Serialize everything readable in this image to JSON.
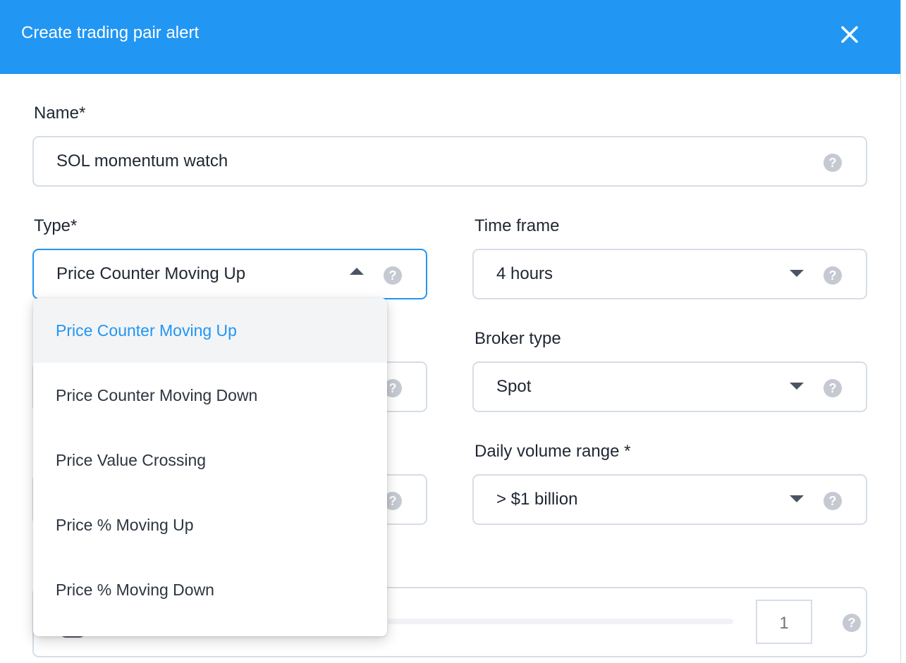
{
  "dialog": {
    "title": "Create trading pair alert",
    "close_icon": "close-icon",
    "accent_color": "#2196f3"
  },
  "form": {
    "name": {
      "label": "Name*",
      "value": "SOL momentum watch"
    },
    "type": {
      "label": "Type*",
      "value": "Price Counter Moving Up",
      "open": true
    },
    "time_frame": {
      "label": "Time frame",
      "value": "4 hours"
    },
    "broker_type": {
      "label": "Broker type",
      "value": "Spot"
    },
    "daily_volume": {
      "label": "Daily volume range *",
      "value": "> $1 billion"
    },
    "count": {
      "value": "1"
    }
  },
  "type_options": [
    {
      "label": "Price Counter Moving Up",
      "selected": true
    },
    {
      "label": "Price Counter Moving Down",
      "selected": false
    },
    {
      "label": "Price Value Crossing",
      "selected": false
    },
    {
      "label": "Price % Moving Up",
      "selected": false
    },
    {
      "label": "Price % Moving Down",
      "selected": false
    }
  ],
  "help_glyph": "?"
}
